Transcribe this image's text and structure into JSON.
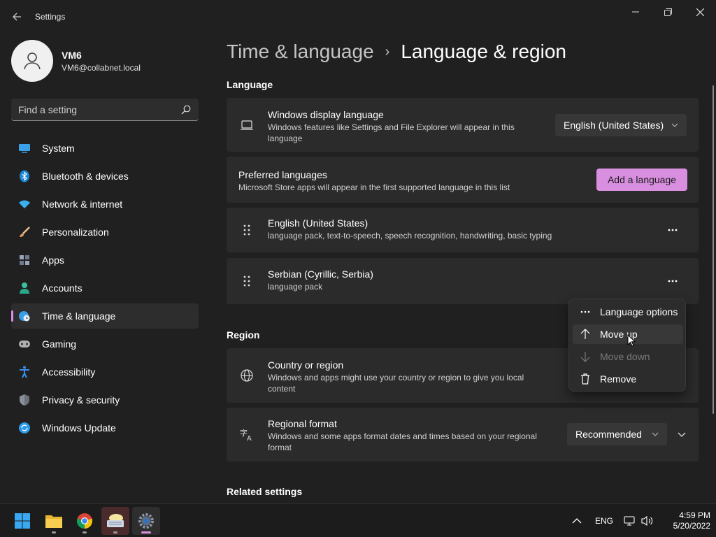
{
  "window": {
    "title": "Settings",
    "back_icon": "back-arrow-icon",
    "controls": [
      "minimize-icon",
      "maximize-icon",
      "close-icon"
    ]
  },
  "profile": {
    "name": "VM6",
    "email": "VM6@collabnet.local"
  },
  "search": {
    "placeholder": "Find a setting"
  },
  "nav": {
    "items": [
      {
        "label": "System",
        "icon": "system-icon",
        "color": "#3aa0e8"
      },
      {
        "label": "Bluetooth & devices",
        "icon": "bluetooth-icon",
        "color": "#1a86d8"
      },
      {
        "label": "Network & internet",
        "icon": "wifi-icon",
        "color": "#3ab0f0"
      },
      {
        "label": "Personalization",
        "icon": "brush-icon",
        "color": "#e8a060"
      },
      {
        "label": "Apps",
        "icon": "apps-icon",
        "color": "#9aa6b8"
      },
      {
        "label": "Accounts",
        "icon": "accounts-icon",
        "color": "#3cc0a0"
      },
      {
        "label": "Time & language",
        "icon": "globe-clock-icon",
        "color": "#3a9ee6"
      },
      {
        "label": "Gaming",
        "icon": "gamepad-icon",
        "color": "#b0b0b0"
      },
      {
        "label": "Accessibility",
        "icon": "accessibility-icon",
        "color": "#3a8ee8"
      },
      {
        "label": "Privacy & security",
        "icon": "shield-icon",
        "color": "#8a8f99"
      },
      {
        "label": "Windows Update",
        "icon": "update-icon",
        "color": "#2c9ae8"
      }
    ],
    "active": "Time & language"
  },
  "breadcrumb": {
    "parent": "Time & language",
    "separator": "›",
    "current": "Language & region"
  },
  "language": {
    "section_title": "Language",
    "display": {
      "title": "Windows display language",
      "desc": "Windows features like Settings and File Explorer will appear in this language",
      "value": "English (United States)"
    },
    "preferred": {
      "title": "Preferred languages",
      "desc": "Microsoft Store apps will appear in the first supported language in this list",
      "add_button": "Add a language"
    },
    "list": [
      {
        "name": "English (United States)",
        "features": "language pack, text-to-speech, speech recognition, handwriting, basic typing"
      },
      {
        "name": "Serbian (Cyrillic, Serbia)",
        "features": "language pack"
      }
    ]
  },
  "context_menu": {
    "items": [
      {
        "label": "Language options",
        "icon": "more-icon",
        "enabled": true
      },
      {
        "label": "Move up",
        "icon": "arrow-up-icon",
        "enabled": true
      },
      {
        "label": "Move down",
        "icon": "arrow-down-icon",
        "enabled": false
      },
      {
        "label": "Remove",
        "icon": "trash-icon",
        "enabled": true
      }
    ],
    "hovered": "Move up"
  },
  "region": {
    "section_title": "Region",
    "country": {
      "title": "Country or region",
      "desc": "Windows and apps might use your country or region to give you local content"
    },
    "format": {
      "title": "Regional format",
      "desc": "Windows and some apps format dates and times based on your regional format",
      "value": "Recommended"
    }
  },
  "related": {
    "section_title": "Related settings"
  },
  "taskbar": {
    "apps": [
      "start-icon",
      "file-explorer-icon",
      "chrome-icon",
      "keyboard-app-icon",
      "settings-gear-icon"
    ],
    "input_language": "ENG",
    "time": "4:59 PM",
    "date": "5/20/2022"
  },
  "colors": {
    "accent": "#d98fe0",
    "background": "#202020",
    "card": "#2b2b2b"
  }
}
